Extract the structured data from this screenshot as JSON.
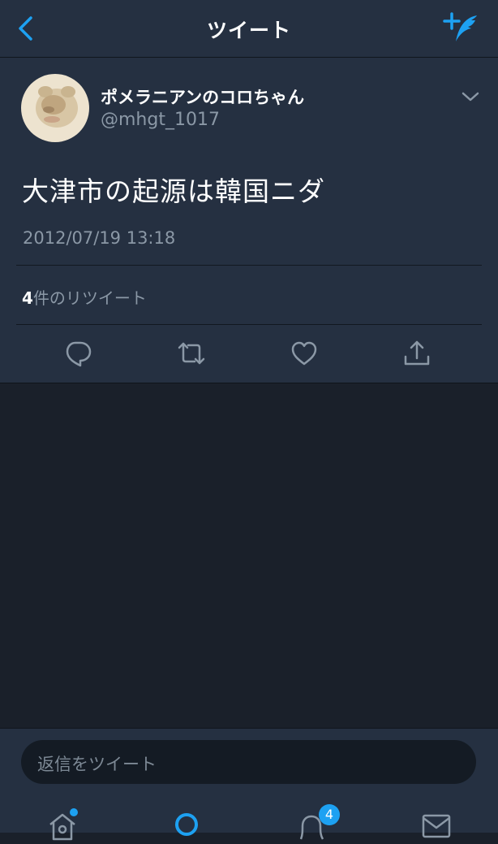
{
  "header": {
    "title": "ツイート",
    "back_icon": "chevron-left-icon",
    "compose_icon": "compose-tweet-icon"
  },
  "tweet": {
    "author": {
      "display_name": "ポメラニアンのコロちゃん",
      "handle": "@mhgt_1017"
    },
    "text": "大津市の起源は韓国ニダ",
    "timestamp": "2012/07/19 13:18",
    "retweets": {
      "count": "4",
      "label": "件のリツイート"
    },
    "actions": [
      "reply-icon",
      "retweet-icon",
      "like-icon",
      "share-icon"
    ]
  },
  "reply": {
    "placeholder": "返信をツイート"
  },
  "tabbar": {
    "notifications_badge": "4"
  },
  "colors": {
    "accent": "#1da1f2",
    "header_bg": "#253041",
    "page_bg": "#1a202a",
    "muted_text": "#8b98a6"
  }
}
